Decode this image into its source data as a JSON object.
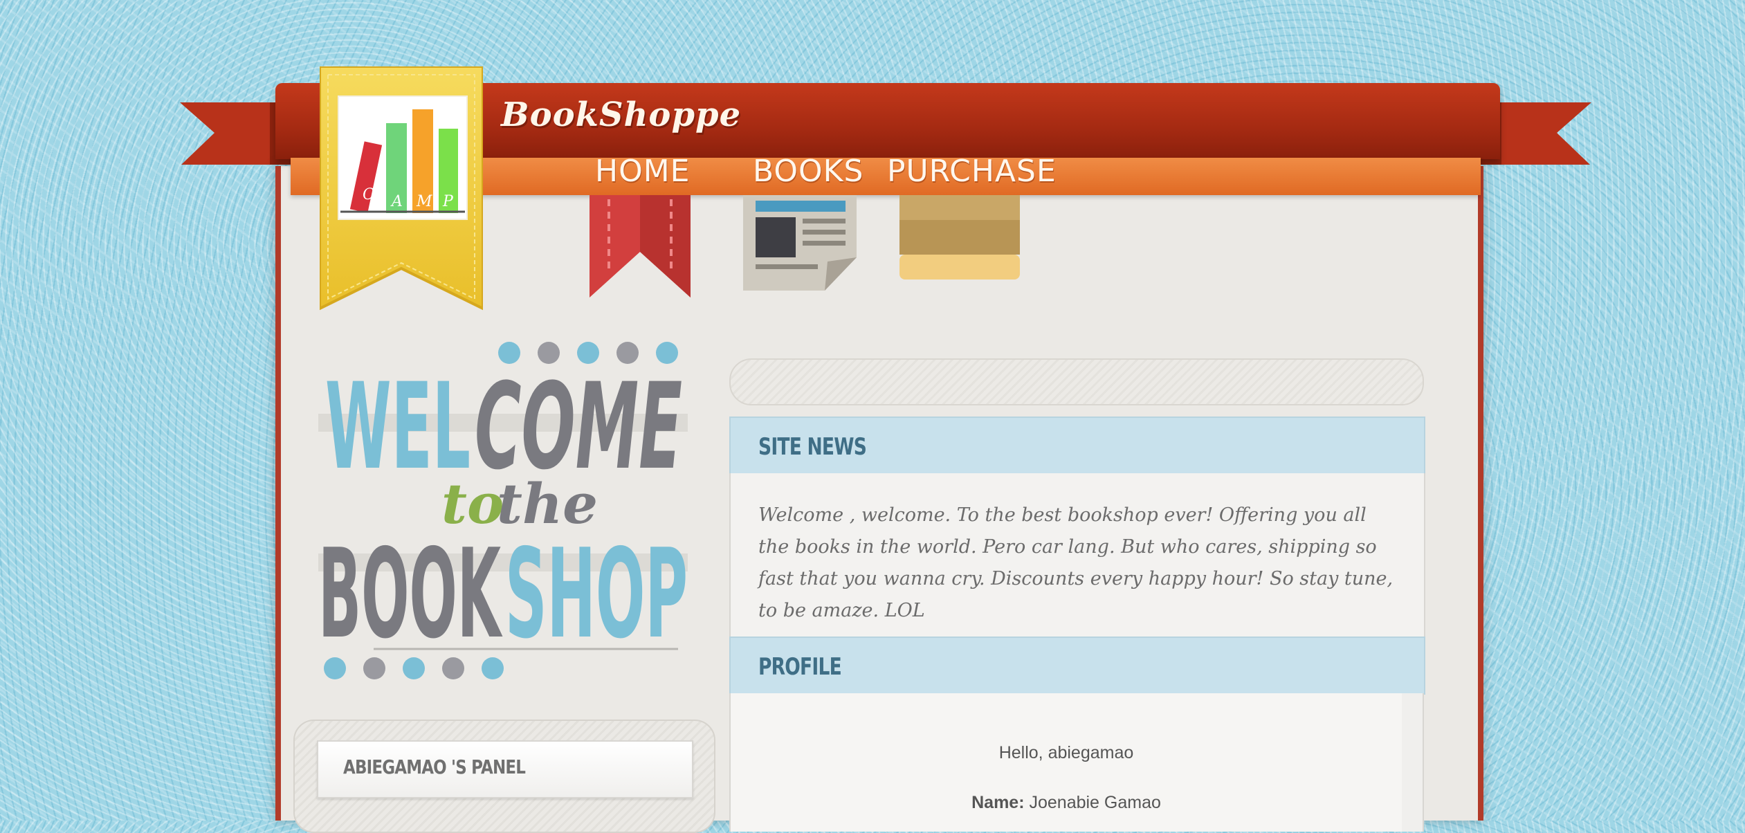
{
  "site": {
    "brand": "BookShoppe",
    "logo_letters": [
      "C",
      "A",
      "M",
      "P"
    ]
  },
  "nav": {
    "items": [
      {
        "label": "HOME",
        "icon": "red-bookmark-icon"
      },
      {
        "label": "BOOKS",
        "icon": "newspaper-icon"
      },
      {
        "label": "PURCHASE",
        "icon": "package-icon"
      }
    ]
  },
  "welcome": {
    "line1a": "WEL",
    "line1b": "COME",
    "line2a": "to",
    "line2b": "the",
    "line3a": "BOOK",
    "line3b": "SHOP"
  },
  "left_panel": {
    "title": "ABIEGAMAO 'S PANEL"
  },
  "search": {
    "placeholder": ""
  },
  "news": {
    "title": "SITE NEWS",
    "text": "Welcome , welcome. To the best bookshop ever! Offering you all the books in the world. Pero car lang. But who cares, shipping so fast that you wanna cry. Discounts every happy hour! So stay tune, to be amaze. LOL"
  },
  "profile": {
    "title": "PROFILE",
    "greeting": "Hello, abiegamao",
    "name_label": "Name:",
    "name_value": "Joenabie Gamao"
  },
  "colors": {
    "accent_red": "#a52a12",
    "accent_orange": "#e06a24",
    "panel_blue": "#c8e1ec",
    "welcome_blue": "#7bbfd6",
    "welcome_grey": "#7a7a80",
    "welcome_green": "#8ab04a"
  }
}
